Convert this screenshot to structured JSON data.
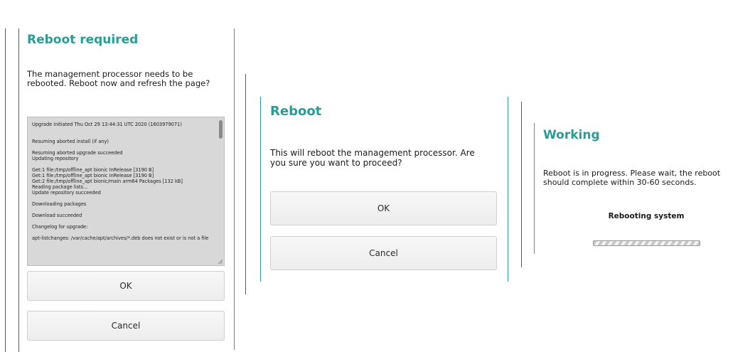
{
  "dialog_reboot_required": {
    "title": "Reboot required",
    "message": "The management processor needs to be rebooted. Reboot now and refresh the page?",
    "log": [
      "Upgrade initiated Thu Oct 29 13:44:31 UTC 2020 (1603979071)",
      "",
      "",
      "Resuming aborted install (if any)",
      "",
      "Resuming aborted upgrade succeeded",
      "Updating repository",
      "",
      "Get:1 file:/tmp/offline_apt bionic InRelease [3190 B]",
      "Get:1 file:/tmp/offline_apt bionic InRelease [3190 B]",
      "Get:2 file:/tmp/offline_apt bionic/main arm64 Packages [132 kB]",
      "Reading package lists...",
      "Update repository succeeded",
      "",
      "Downloading packages",
      "",
      "Download succeeded",
      "",
      "Changelog for upgrade:",
      "",
      "apt-listchanges: /var/cache/apt/archives/*.deb does not exist or is not a file"
    ],
    "ok_label": "OK",
    "cancel_label": "Cancel"
  },
  "dialog_reboot": {
    "title": "Reboot",
    "message": "This will reboot the management processor. Are you sure you want to proceed?",
    "ok_label": "OK",
    "cancel_label": "Cancel"
  },
  "dialog_working": {
    "title": "Working",
    "message": "Reboot is in progress. Please wait, the reboot should complete within 30-60 seconds.",
    "status": "Rebooting system",
    "progress": "indeterminate"
  },
  "colors": {
    "title_accent": "#2a9c95",
    "divider_accent": "#2aa3a3",
    "log_background": "#d8d8d8"
  },
  "icons": [
    "resize-grip-icon"
  ]
}
